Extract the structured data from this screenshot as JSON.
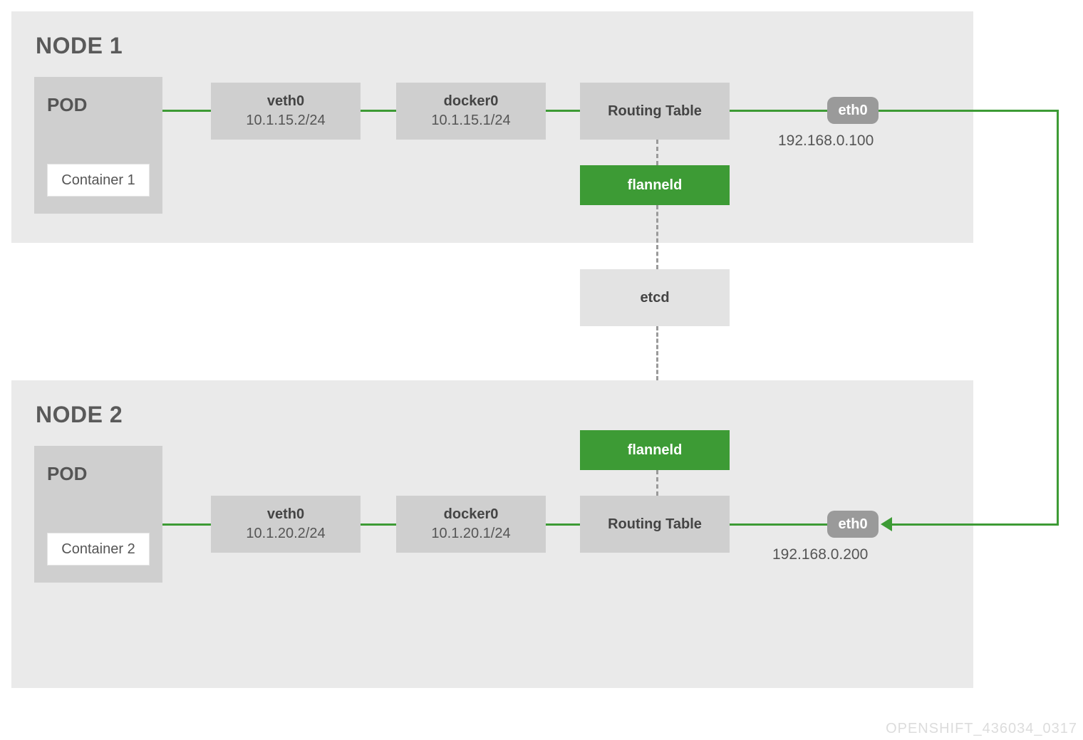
{
  "watermark": "OPENSHIFT_436034_0317",
  "etcd": {
    "label": "etcd"
  },
  "node1": {
    "title": "NODE 1",
    "pod": {
      "label": "POD",
      "container": "Container 1"
    },
    "veth": {
      "name": "veth0",
      "addr": "10.1.15.2/24"
    },
    "docker": {
      "name": "docker0",
      "addr": "10.1.15.1/24"
    },
    "routing": {
      "label": "Routing Table"
    },
    "flanneld": {
      "label": "flanneld"
    },
    "eth": {
      "label": "eth0",
      "addr": "192.168.0.100"
    }
  },
  "node2": {
    "title": "NODE 2",
    "pod": {
      "label": "POD",
      "container": "Container 2"
    },
    "veth": {
      "name": "veth0",
      "addr": "10.1.20.2/24"
    },
    "docker": {
      "name": "docker0",
      "addr": "10.1.20.1/24"
    },
    "routing": {
      "label": "Routing Table"
    },
    "flanneld": {
      "label": "flanneld"
    },
    "eth": {
      "label": "eth0",
      "addr": "192.168.0.200"
    }
  }
}
